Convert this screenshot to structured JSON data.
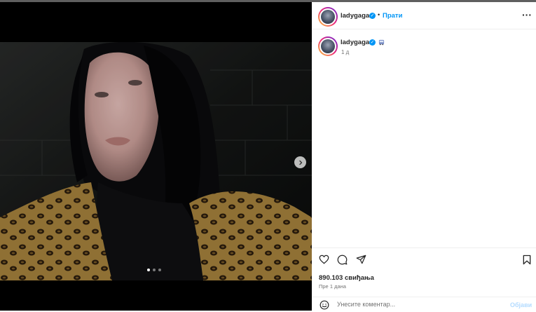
{
  "post": {
    "username": "ladygaga",
    "follow_label": "Прати",
    "separator": "•",
    "more_label": "···"
  },
  "caption": {
    "username": "ladygaga",
    "time": "1 д"
  },
  "carousel": {
    "slide_count": 3,
    "active_index": 0
  },
  "engagement": {
    "likes": "890.103 свиђања",
    "posted": "Пре 1 дана"
  },
  "comment": {
    "placeholder": "Унесите коментар...",
    "publish_label": "Објави"
  },
  "colors": {
    "accent": "#0095f6",
    "text": "#262626",
    "muted": "#737373"
  },
  "icons": [
    "heart-icon",
    "comment-icon",
    "share-icon",
    "bookmark-icon",
    "emoji-icon",
    "chevron-right-icon",
    "verified-icon"
  ]
}
